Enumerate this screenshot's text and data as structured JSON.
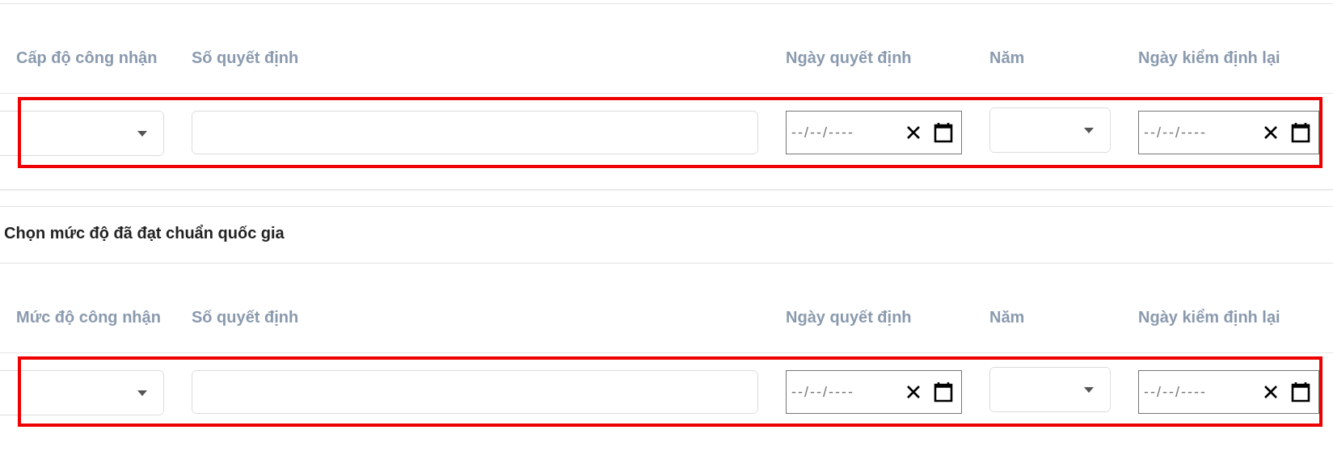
{
  "sections": [
    {
      "columns": [
        "Cấp độ công nhận",
        "Số quyết định",
        "Ngày quyết định",
        "Năm",
        "Ngày kiểm định lại"
      ],
      "row": {
        "highlighted": true,
        "fields": [
          {
            "kind": "select"
          },
          {
            "kind": "text"
          },
          {
            "kind": "date",
            "placeholder": "--/--/----"
          },
          {
            "kind": "select"
          },
          {
            "kind": "date",
            "placeholder": "--/--/----"
          }
        ]
      }
    },
    {
      "heading": "Chọn mức độ đã đạt chuẩn quốc gia",
      "columns": [
        "Mức độ công nhận",
        "Số quyết định",
        "Ngày quyết định",
        "Năm",
        "Ngày kiểm định lại"
      ],
      "row": {
        "highlighted": true,
        "fields": [
          {
            "kind": "select"
          },
          {
            "kind": "text"
          },
          {
            "kind": "date",
            "placeholder": "--/--/----"
          },
          {
            "kind": "select"
          },
          {
            "kind": "date",
            "placeholder": "--/--/----"
          }
        ]
      }
    }
  ]
}
